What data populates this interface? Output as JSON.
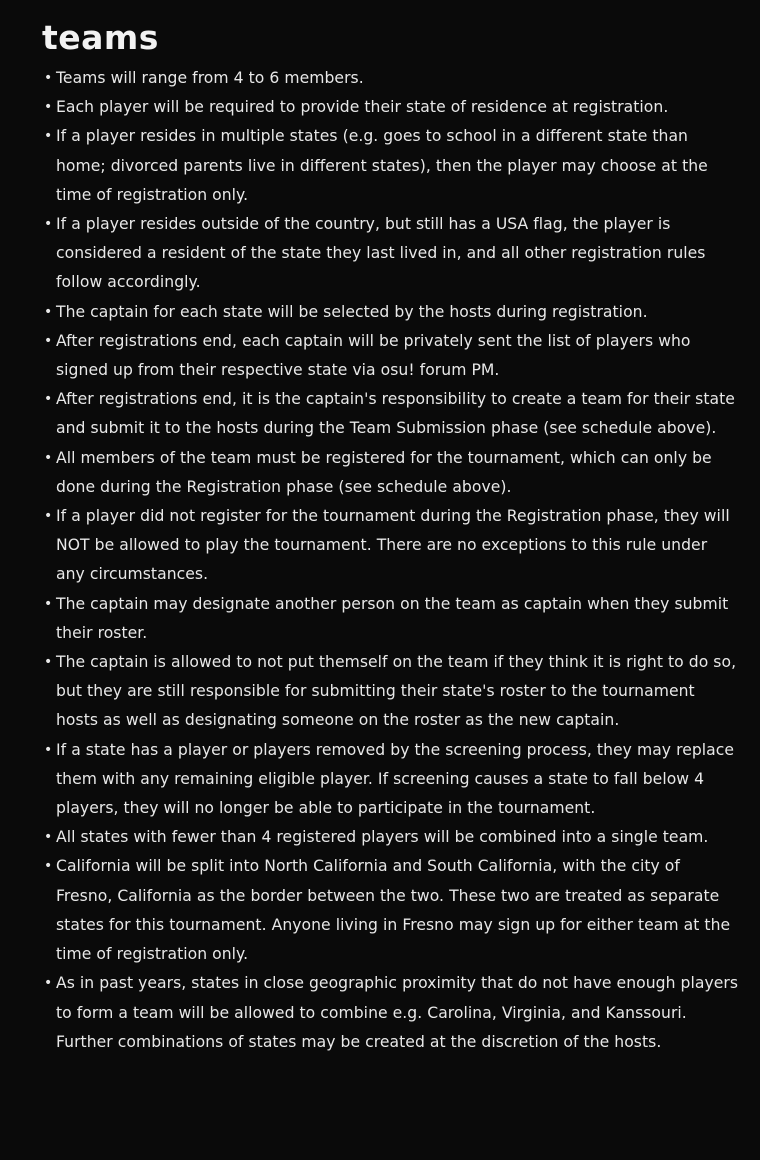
{
  "heading": "teams",
  "rules": [
    "Teams will range from 4 to 6 members.",
    "Each player will be required to provide their state of residence at registration.",
    "If a player resides in multiple states (e.g. goes to school in a different state than home; divorced parents live in different states), then the player may choose at the time of registration only.",
    "If a player resides outside of the country, but still has a USA flag, the player is considered a resident of the state they last lived in, and all other registration rules follow accordingly.",
    "The captain for each state will be selected by the hosts during registration.",
    "After registrations end, each captain will be privately sent the list of players who signed up from their respective state via osu! forum PM.",
    "After registrations end, it is the captain's responsibility to create a team for their state and submit it to the hosts during the Team Submission phase (see schedule above).",
    "All members of the team must be registered for the tournament, which can only be done during the Registration phase (see schedule above).",
    "If a player did not register for the tournament during the Registration phase, they will NOT be allowed to play the tournament. There are no exceptions to this rule under any circumstances.",
    "The captain may designate another person on the team as captain when they submit their roster.",
    "The captain is allowed to not put themself on the team if they think it is right to do so, but they are still responsible for submitting their state's roster to the tournament hosts as well as designating someone on the roster as the new captain.",
    "If a state has a player or players removed by the screening process, they may replace them with any remaining eligible player. If screening causes a state to fall below 4 players, they will no longer be able to participate in the tournament.",
    "All states with fewer than 4 registered players will be combined into a single team.",
    "California will be split into North California and South California, with the city of Fresno, California as the border between the two. These two are treated as separate states for this tournament. Anyone living in Fresno may sign up for either team at the time of registration only.",
    "As in past years, states in close geographic proximity that do not have enough players to form a team will be allowed to combine e.g. Carolina, Virginia, and Kanssouri. Further combinations of states may be created at the discretion of the hosts."
  ]
}
